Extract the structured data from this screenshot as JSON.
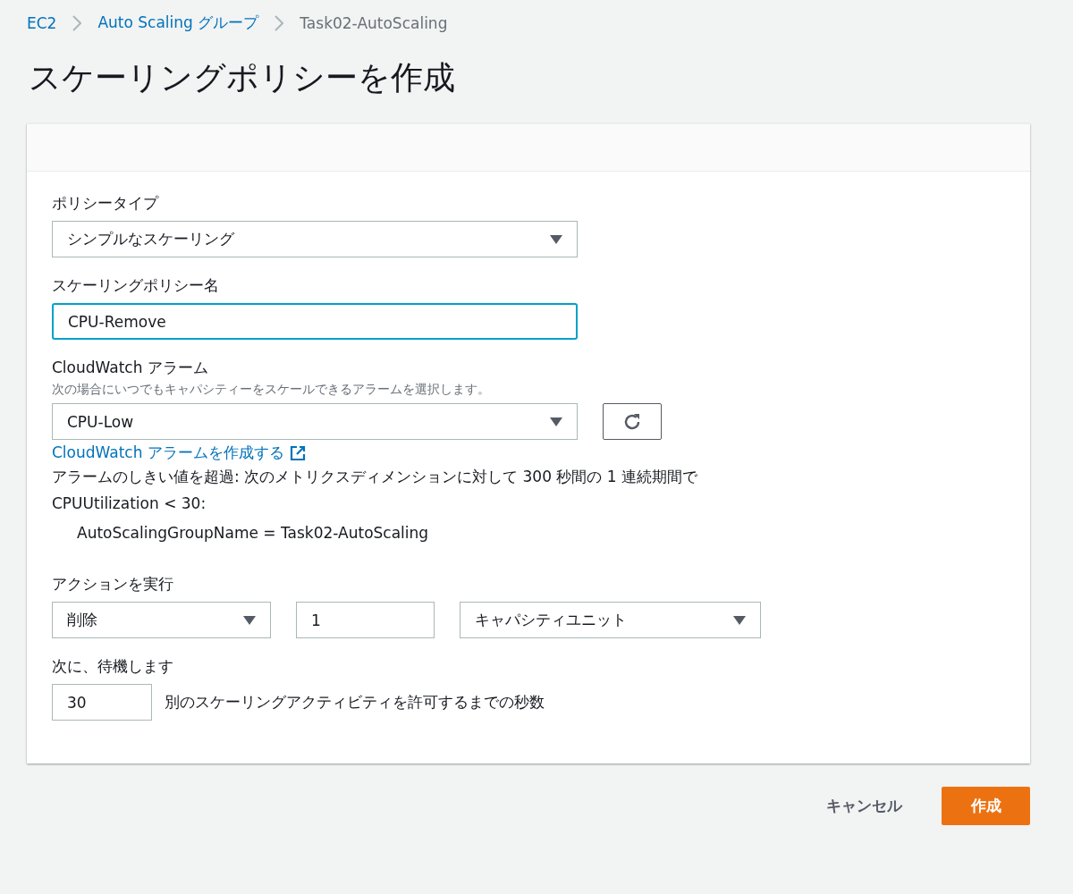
{
  "breadcrumbs": [
    {
      "label": "EC2",
      "link": true
    },
    {
      "label": "Auto Scaling グループ",
      "link": true
    },
    {
      "label": "Task02-AutoScaling",
      "link": false
    }
  ],
  "title": "スケーリングポリシーを作成",
  "form": {
    "policy_type": {
      "label": "ポリシータイプ",
      "value": "シンプルなスケーリング"
    },
    "policy_name": {
      "label": "スケーリングポリシー名",
      "value": "CPU-Remove",
      "focused": true
    },
    "alarm": {
      "label": "CloudWatch アラーム",
      "description": "次の場合にいつでもキャパシティーをスケールできるアラームを選択します。",
      "value": "CPU-Low",
      "create_link": "CloudWatch アラームを作成する",
      "breach_text": "アラームのしきい値を超過: 次のメトリクスディメンションに対して 300 秒間の 1 連続期間で CPUUtilization < 30:",
      "dimension": "AutoScalingGroupName = Task02-AutoScaling"
    },
    "action": {
      "label": "アクションを実行",
      "operation": "削除",
      "amount": "1",
      "unit": "キャパシティユニット"
    },
    "wait": {
      "label": "次に、待機します",
      "value": "30",
      "suffix": "別のスケーリングアクティビティを許可するまでの秒数"
    }
  },
  "buttons": [
    {
      "label": "キャンセル",
      "kind": "link"
    },
    {
      "label": "作成",
      "kind": "primary"
    }
  ]
}
